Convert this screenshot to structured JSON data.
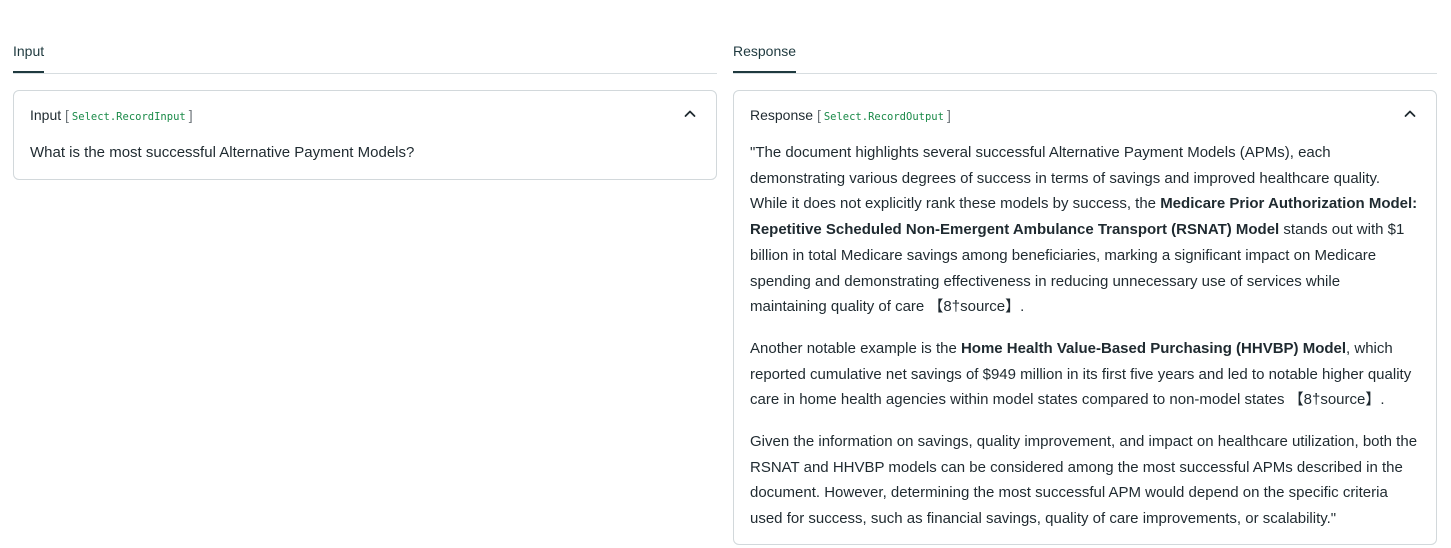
{
  "input_panel": {
    "tab_label": "Input",
    "card_title": "Input",
    "bracket_open": "[",
    "bracket_close": "]",
    "code_label": "Select.RecordInput",
    "text": "What is the most successful Alternative Payment Models?"
  },
  "response_panel": {
    "tab_label": "Response",
    "card_title": "Response",
    "bracket_open": "[",
    "bracket_close": "]",
    "code_label": "Select.RecordOutput",
    "p1_a": "\"The document highlights several successful Alternative Payment Models (APMs), each demonstrating various degrees of success in terms of savings and improved healthcare quality. While it does not explicitly rank these models by success, the ",
    "p1_bold": "Medicare Prior Authorization Model: Repetitive Scheduled Non-Emergent Ambulance Transport (RSNAT) Model",
    "p1_b": " stands out with $1 billion in total Medicare savings among beneficiaries, marking a significant impact on Medicare spending and demonstrating effectiveness in reducing unnecessary use of services while maintaining quality of care 【8†source】.",
    "p2_a": "Another notable example is the ",
    "p2_bold": "Home Health Value-Based Purchasing (HHVBP) Model",
    "p2_b": ", which reported cumulative net savings of $949 million in its first five years and led to notable higher quality care in home health agencies within model states compared to non-model states 【8†source】.",
    "p3": "Given the information on savings, quality improvement, and impact on healthcare utilization, both the RSNAT and HHVBP models can be considered among the most successful APMs described in the document. However, determining the most successful APM would depend on the specific criteria used for success, such as financial savings, quality of care improvements, or scalability.\""
  },
  "icons": {
    "collapse": "chevron-up-icon"
  }
}
